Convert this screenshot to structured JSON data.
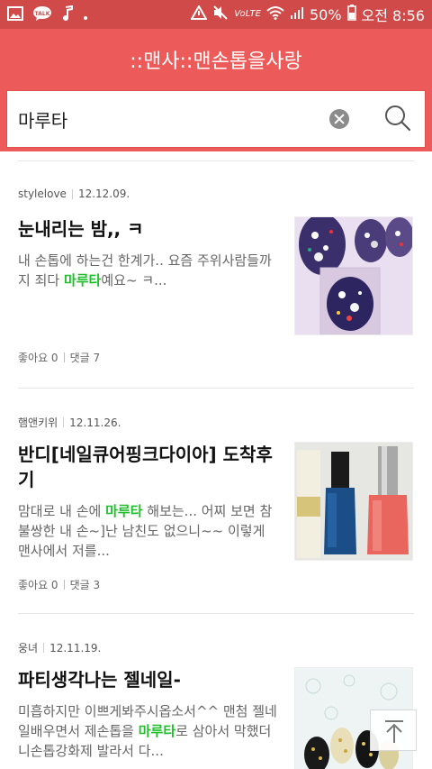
{
  "status_bar": {
    "battery": "50%",
    "time": "오전 8:56",
    "volte": "VoLTE",
    "talk_badge": "TALK"
  },
  "header": {
    "title": "::맨사::맨손톱을사랑"
  },
  "search": {
    "query": "마루타"
  },
  "colors": {
    "status_bar": "#cf4a48",
    "header": "#ec5b59",
    "highlight": "#1fbf2b"
  },
  "posts": [
    {
      "author": "stylelove",
      "date": "12.12.09.",
      "title": "눈내리는 밤,, ㅋ",
      "snippet_before": "내 손톱에 하는건 한계가.. 요즘 주위사람들까지 죄다 ",
      "snippet_highlight": "마루타",
      "snippet_after": "예요~ ㅋ...",
      "likes": "좋아요 0",
      "comments": "댓글 7"
    },
    {
      "author": "햄앤키위",
      "date": "12.11.26.",
      "title": "반디[네일큐어핑크다이아] 도착후기",
      "snippet_before": "맘대로 내 손에 ",
      "snippet_highlight": "마루타",
      "snippet_after": " 해보는... 어찌 보면 참 불쌍한 내 손~]난 남친도 없으니~~ 이렇게 맨사에서 저를...",
      "likes": "좋아요 0",
      "comments": "댓글 3"
    },
    {
      "author": "웅녀",
      "date": "12.11.19.",
      "title": "파티생각나는 젤네일-",
      "snippet_before": "미흡하지만 이쁘게봐주시옵소서^^ 맨첨 젤네일배우면서 제손톱을 ",
      "snippet_highlight": "마루타",
      "snippet_after": "로 삼아서 막했더니손톱강화제 발라서 다...",
      "likes": "",
      "comments": ""
    }
  ]
}
